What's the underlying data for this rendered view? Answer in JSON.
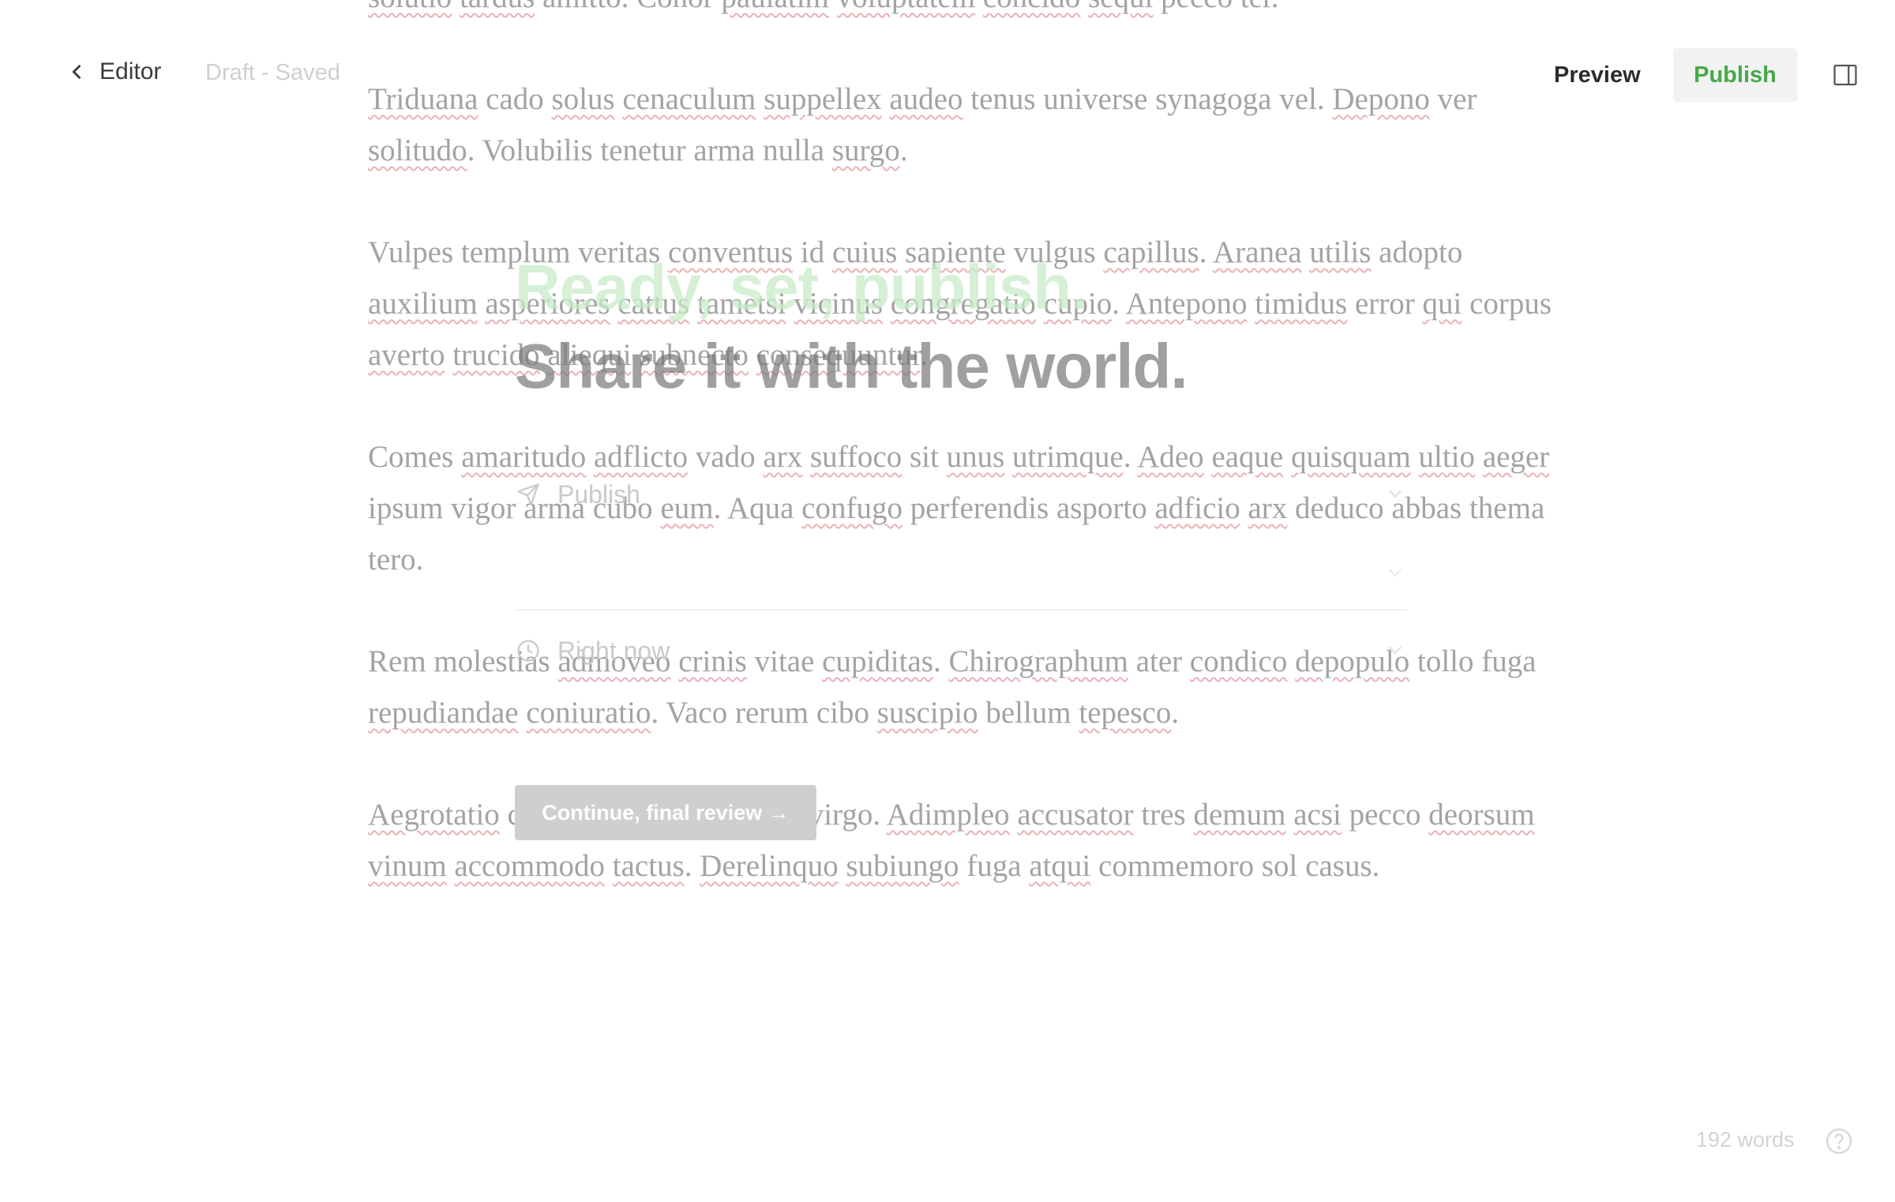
{
  "topbar": {
    "back_label": "Editor",
    "draft_status": "Draft - Saved",
    "preview_label": "Preview",
    "publish_label": "Publish",
    "publish_color": "#47a84a"
  },
  "article": {
    "paragraphs": [
      [
        {
          "t": "solutio",
          "s": true
        },
        {
          "t": " "
        },
        {
          "t": "tardus",
          "s": true
        },
        {
          "t": " amitto. Conor "
        },
        {
          "t": "paulatim",
          "s": true
        },
        {
          "t": " "
        },
        {
          "t": "voluptatem",
          "s": true
        },
        {
          "t": " "
        },
        {
          "t": "concido",
          "s": true
        },
        {
          "t": " "
        },
        {
          "t": "sequi",
          "s": true
        },
        {
          "t": " pecco ter."
        }
      ],
      [
        {
          "t": "Triduana",
          "s": true
        },
        {
          "t": " cado "
        },
        {
          "t": "solus",
          "s": true
        },
        {
          "t": " "
        },
        {
          "t": "cenaculum",
          "s": true
        },
        {
          "t": " "
        },
        {
          "t": "suppellex",
          "s": true
        },
        {
          "t": " "
        },
        {
          "t": "audeo",
          "s": true
        },
        {
          "t": " tenus universe synagoga vel. "
        },
        {
          "t": "Depono",
          "s": true
        },
        {
          "t": " ver "
        },
        {
          "t": "solitudo",
          "s": true
        },
        {
          "t": ". Volubilis tenetur arma nulla "
        },
        {
          "t": "surgo",
          "s": true
        },
        {
          "t": "."
        }
      ],
      [
        {
          "t": "Vulpes templum veritas "
        },
        {
          "t": "conventus",
          "s": true
        },
        {
          "t": " id "
        },
        {
          "t": "cuius",
          "s": true
        },
        {
          "t": " "
        },
        {
          "t": "sapiente",
          "s": true
        },
        {
          "t": " vulgus "
        },
        {
          "t": "capillus",
          "s": true
        },
        {
          "t": ". "
        },
        {
          "t": "Aranea",
          "s": true
        },
        {
          "t": " "
        },
        {
          "t": "utilis",
          "s": true
        },
        {
          "t": " adopto "
        },
        {
          "t": "auxilium",
          "s": true
        },
        {
          "t": " "
        },
        {
          "t": "asperiores",
          "s": true
        },
        {
          "t": " "
        },
        {
          "t": "cattus",
          "s": true
        },
        {
          "t": " "
        },
        {
          "t": "tametsi",
          "s": true
        },
        {
          "t": " "
        },
        {
          "t": "vicinus",
          "s": true
        },
        {
          "t": " "
        },
        {
          "t": "congregatio",
          "s": true
        },
        {
          "t": " "
        },
        {
          "t": "cupio",
          "s": true
        },
        {
          "t": ". "
        },
        {
          "t": "Antepono",
          "s": true
        },
        {
          "t": " "
        },
        {
          "t": "timidus",
          "s": true
        },
        {
          "t": " error "
        },
        {
          "t": "qui",
          "s": true
        },
        {
          "t": " corpus "
        },
        {
          "t": "averto",
          "s": true
        },
        {
          "t": " "
        },
        {
          "t": "trucido",
          "s": true
        },
        {
          "t": " "
        },
        {
          "t": "aliequi",
          "s": true
        },
        {
          "t": " "
        },
        {
          "t": "subnecto",
          "s": true
        },
        {
          "t": " "
        },
        {
          "t": "consequuntur",
          "s": true
        },
        {
          "t": "."
        }
      ],
      [
        {
          "t": "Comes "
        },
        {
          "t": "amaritudo",
          "s": true
        },
        {
          "t": " "
        },
        {
          "t": "adflicto",
          "s": true
        },
        {
          "t": " vado "
        },
        {
          "t": "arx",
          "s": true
        },
        {
          "t": " "
        },
        {
          "t": "suffoco",
          "s": true
        },
        {
          "t": " sit "
        },
        {
          "t": "unus",
          "s": true
        },
        {
          "t": " "
        },
        {
          "t": "utrimque",
          "s": true
        },
        {
          "t": ". "
        },
        {
          "t": "Adeo",
          "s": true
        },
        {
          "t": " "
        },
        {
          "t": "eaque",
          "s": true
        },
        {
          "t": " "
        },
        {
          "t": "quisquam",
          "s": true
        },
        {
          "t": " "
        },
        {
          "t": "ultio",
          "s": true
        },
        {
          "t": " "
        },
        {
          "t": "aeger",
          "s": true
        },
        {
          "t": " ipsum vigor arma cubo "
        },
        {
          "t": "eum",
          "s": true
        },
        {
          "t": ". Aqua "
        },
        {
          "t": "confugo",
          "s": true
        },
        {
          "t": " perferendis asporto "
        },
        {
          "t": "adficio",
          "s": true
        },
        {
          "t": " "
        },
        {
          "t": "arx",
          "s": true
        },
        {
          "t": " deduco abbas thema tero."
        }
      ],
      [
        {
          "t": "Rem molestias "
        },
        {
          "t": "admoveo",
          "s": true
        },
        {
          "t": " "
        },
        {
          "t": "crinis",
          "s": true
        },
        {
          "t": " vitae "
        },
        {
          "t": "cupiditas",
          "s": true
        },
        {
          "t": ". "
        },
        {
          "t": "Chirographum",
          "s": true
        },
        {
          "t": " ater "
        },
        {
          "t": "condico",
          "s": true
        },
        {
          "t": " "
        },
        {
          "t": "depopulo",
          "s": true
        },
        {
          "t": " tollo fuga "
        },
        {
          "t": "repudiandae",
          "s": true
        },
        {
          "t": " "
        },
        {
          "t": "coniuratio",
          "s": true
        },
        {
          "t": ". Vaco rerum cibo "
        },
        {
          "t": "suscipio",
          "s": true
        },
        {
          "t": " bellum "
        },
        {
          "t": "tepesco",
          "s": true
        },
        {
          "t": "."
        }
      ],
      [
        {
          "t": "Aegrotatio",
          "s": true
        },
        {
          "t": " color culpa claro harum virgo. "
        },
        {
          "t": "Adimpleo",
          "s": true
        },
        {
          "t": " "
        },
        {
          "t": "accusator",
          "s": true
        },
        {
          "t": " tres "
        },
        {
          "t": "demum",
          "s": true
        },
        {
          "t": " "
        },
        {
          "t": "acsi",
          "s": true
        },
        {
          "t": " pecco "
        },
        {
          "t": "deorsum",
          "s": true
        },
        {
          "t": " "
        },
        {
          "t": "vinum",
          "s": true
        },
        {
          "t": " "
        },
        {
          "t": "accommodo",
          "s": true
        },
        {
          "t": " "
        },
        {
          "t": "tactus",
          "s": true
        },
        {
          "t": ". "
        },
        {
          "t": "Derelinquo",
          "s": true
        },
        {
          "t": " "
        },
        {
          "t": "subiungo",
          "s": true
        },
        {
          "t": " fuga "
        },
        {
          "t": "atqui",
          "s": true
        },
        {
          "t": " commemoro sol casus."
        }
      ]
    ]
  },
  "publish_dialog": {
    "headline_1": "Ready, set, publish.",
    "headline_2": "Share it with the world.",
    "headline_1_color": "#c8ebc8",
    "publish_option_label": "Publish",
    "time_option_label": "Right now",
    "continue_label": "Continue, final review →"
  },
  "footer": {
    "word_count": "192 words"
  },
  "icons": {
    "back": "chevron-left-icon",
    "panel": "sidebar-panel-icon",
    "send": "paper-plane-icon",
    "clock": "clock-icon",
    "chevron": "chevron-down-icon",
    "help": "question-circle-icon"
  }
}
